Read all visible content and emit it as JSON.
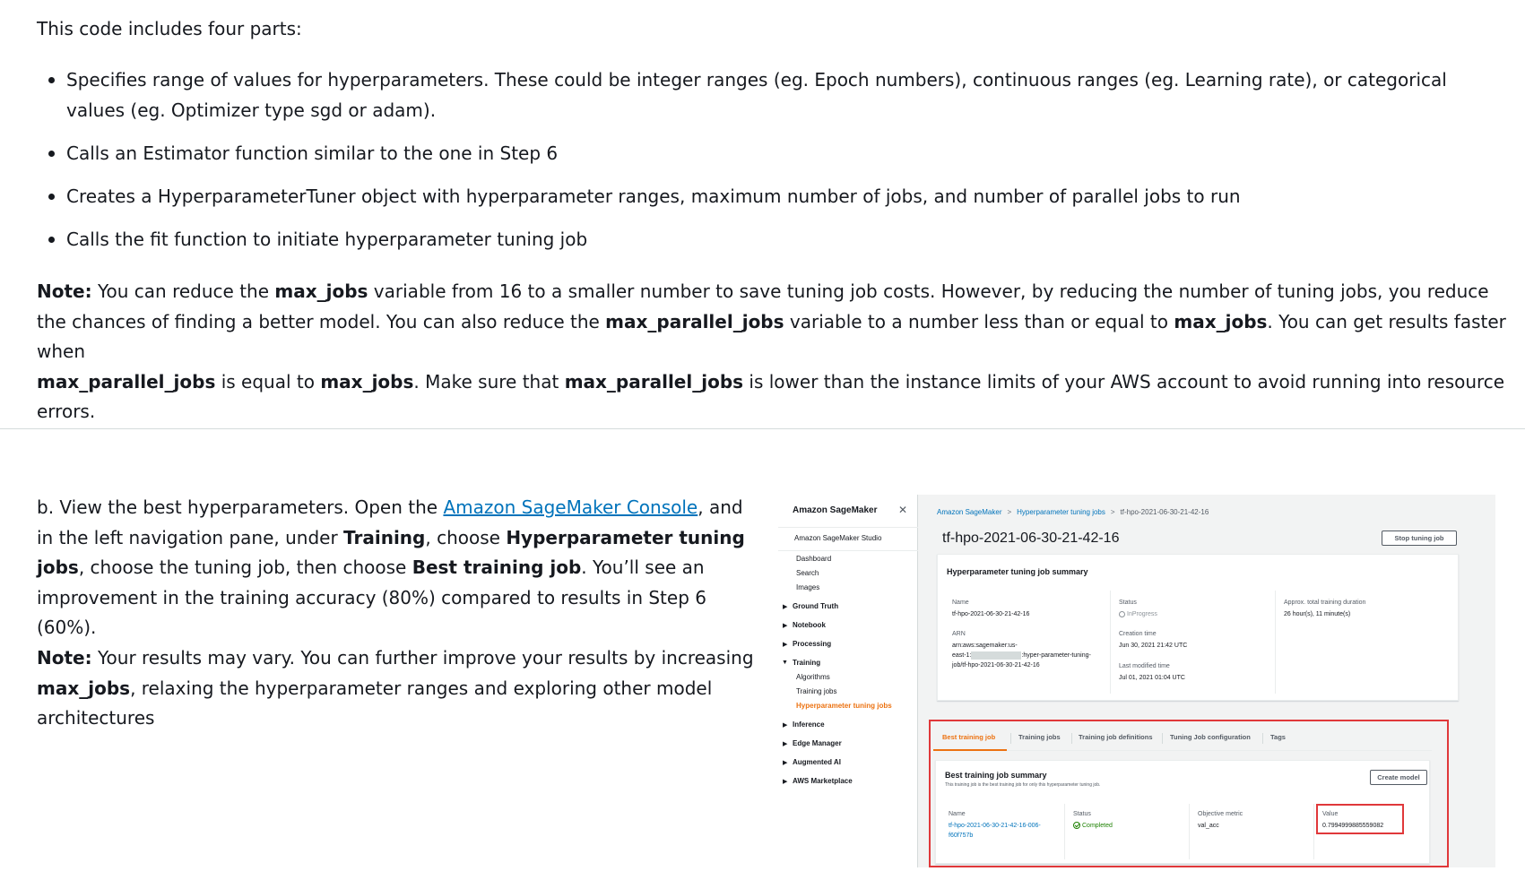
{
  "article": {
    "intro": "This code includes four parts:",
    "bullets": [
      "Specifies range of values for hyperparameters. These could be integer ranges (eg. Epoch numbers), continuous ranges (eg. Learning rate), or categorical values (eg. Optimizer type sgd or adam).",
      "Calls an Estimator function similar to the one in Step 6",
      "Creates a HyperparameterTuner object with hyperparameter ranges, maximum number of jobs, and number of parallel jobs to run",
      "Calls the fit function to initiate hyperparameter tuning job"
    ],
    "note1": {
      "label": "Note:",
      "t1": " You can reduce the ",
      "b1": "max_jobs",
      "t2": " variable from 16 to a smaller number to save tuning job costs. However, by reducing the number of tuning jobs, you reduce the chances of finding a better model. You can also reduce the ",
      "b2": "max_parallel_jobs",
      "t3": " variable to a number less than or equal to ",
      "b3": "max_jobs",
      "t4": ". You can get results faster when ",
      "b4": "max_parallel_jobs",
      "t5": " is equal to ",
      "b5": "max_jobs",
      "t6": ". Make sure that ",
      "b6": "max_parallel_jobs",
      "t7": " is lower than the instance limits of your AWS account to avoid running into resource errors."
    },
    "stepb": {
      "t1": "b. View the best hyperparameters. Open the ",
      "link": "Amazon SageMaker Console",
      "t2": ", and in the left navigation pane, under ",
      "b1": "Training",
      "t3": ", choose ",
      "b2": "Hyperparameter tuning jobs",
      "t4": ", choose the tuning job,  then choose ",
      "b3": "Best training job",
      "t5": ". You’ll see an improvement in the training accuracy (80%) compared to results in Step 6 (60%)."
    },
    "note2": {
      "label": "Note:",
      "t1": " Your results may vary. You can further improve your results by increasing ",
      "b1": "max_jobs",
      "t2": ", relaxing the hyperparameter ranges and exploring other model architectures"
    }
  },
  "console": {
    "brand": "Amazon SageMaker",
    "close_glyph": "✕",
    "nav": {
      "studio": "Amazon SageMaker Studio",
      "dashboard": "Dashboard",
      "search": "Search",
      "images": "Images",
      "ground_truth": "Ground Truth",
      "notebook": "Notebook",
      "processing": "Processing",
      "training": "Training",
      "algorithms": "Algorithms",
      "training_jobs": "Training jobs",
      "hpt_jobs": "Hyperparameter tuning jobs",
      "inference": "Inference",
      "edge_manager": "Edge Manager",
      "augmented_ai": "Augmented AI",
      "aws_marketplace": "AWS Marketplace"
    },
    "breadcrumb": [
      "Amazon SageMaker",
      "Hyperparameter tuning jobs",
      "tf-hpo-2021-06-30-21-42-16"
    ],
    "breadcrumb_sep": ">",
    "title": "tf-hpo-2021-06-30-21-42-16",
    "stop_button": "Stop tuning job",
    "summary": {
      "heading": "Hyperparameter tuning job summary",
      "name_label": "Name",
      "name_value": "tf-hpo-2021-06-30-21-42-16",
      "arn_label": "ARN",
      "arn_line1": "arn:aws:sagemaker:us-",
      "arn_line2a": "east-1:",
      "arn_line2b": ":hyper-parameter-tuning-",
      "arn_line3": "job/tf-hpo-2021-06-30-21-42-16",
      "status_label": "Status",
      "status_value": "InProgress",
      "creation_label": "Creation time",
      "creation_value": "Jun 30, 2021 21:42 UTC",
      "modified_label": "Last modified time",
      "modified_value": "Jul 01, 2021 01:04 UTC",
      "duration_label": "Approx. total training duration",
      "duration_value": "26 hour(s), 11 minute(s)"
    },
    "tabs": [
      "Best training job",
      "Training jobs",
      "Training job definitions",
      "Tuning Job configuration",
      "Tags"
    ],
    "best": {
      "heading": "Best training job summary",
      "subtitle": "This training job is the best training job for only this hyperparameter tuning job.",
      "create_button": "Create model",
      "name_label": "Name",
      "name_line1": "tf-hpo-2021-06-30-21-42-16-006-",
      "name_line2": "f60f757b",
      "status_label": "Status",
      "status_value": "Completed",
      "metric_label": "Objective metric",
      "metric_value": "val_acc",
      "value_label": "Value",
      "value_value": "0.7994999885559082"
    },
    "colors": {
      "link": "#0073bb",
      "accent": "#ec7211",
      "highlight": "#e0383a",
      "success": "#1d8102"
    }
  }
}
